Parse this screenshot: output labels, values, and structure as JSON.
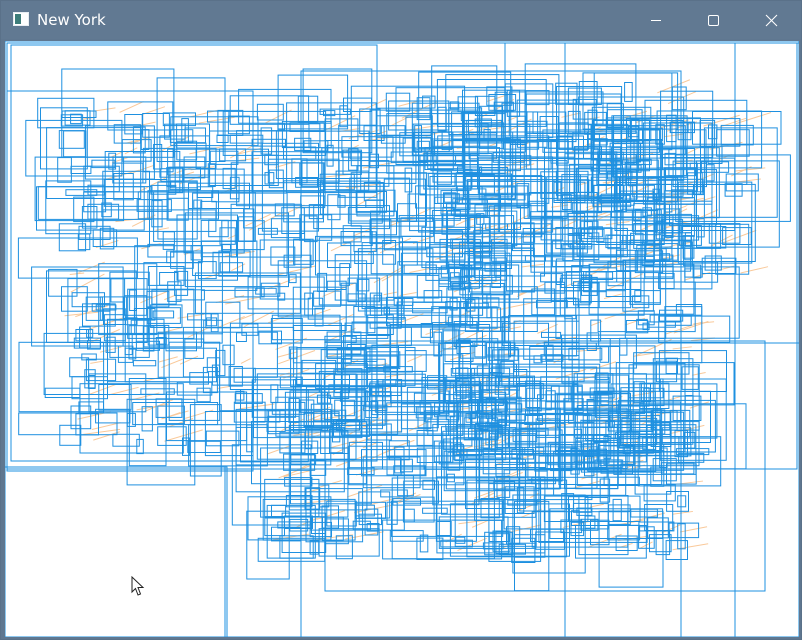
{
  "window": {
    "title": "New York",
    "icon": "app-window-icon",
    "controls": [
      {
        "name": "minimize",
        "icon": "minimize-icon"
      },
      {
        "name": "maximize",
        "icon": "maximize-icon"
      },
      {
        "name": "close",
        "icon": "close-icon"
      }
    ]
  },
  "canvas": {
    "box_color": "#1e90e0",
    "map_color": "#f9c99a",
    "background": "#ffffff"
  },
  "cursor": {
    "icon": "mouse-pointer-icon"
  }
}
